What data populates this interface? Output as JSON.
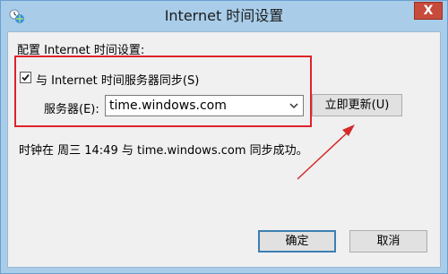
{
  "window": {
    "title": "Internet 时间设置",
    "close_label": "X"
  },
  "section_label": "配置 Internet 时间设置:",
  "sync": {
    "checkbox_label": "与 Internet 时间服务器同步(S)",
    "checked": true
  },
  "server": {
    "label": "服务器(E):",
    "selected": "time.windows.com"
  },
  "update_button": "立即更新(U)",
  "status_text": "时钟在 周三 14:49 与 time.windows.com 同步成功。",
  "buttons": {
    "ok": "确定",
    "cancel": "取消"
  },
  "colors": {
    "highlight_border": "#e0222a",
    "arrow": "#d42a2a",
    "titlebar": "#a9cde9"
  }
}
